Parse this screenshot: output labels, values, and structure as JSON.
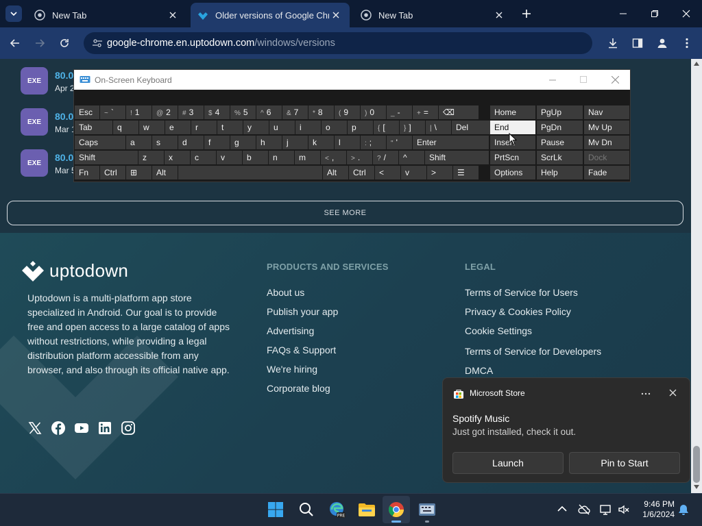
{
  "browser": {
    "tabs": [
      {
        "title": "New Tab",
        "active": false
      },
      {
        "title": "Older versions of Google Chrom",
        "active": true
      },
      {
        "title": "New Tab",
        "active": false
      }
    ],
    "url_host": "google-chrome.en.uptodown.com",
    "url_path": "/windows/versions"
  },
  "page": {
    "versions": [
      {
        "badge": "EXE",
        "number": "80.0",
        "date": "Apr 2"
      },
      {
        "badge": "EXE",
        "number": "80.0",
        "date": "Mar 1"
      },
      {
        "badge": "EXE",
        "number": "80.0",
        "date": "Mar 5"
      }
    ],
    "see_more": "SEE MORE",
    "footer": {
      "brand": "uptodown",
      "about": "Uptodown is a multi-platform app store specialized in Android. Our goal is to provide free and open access to a large catalog of apps without restrictions, while providing a legal distribution platform accessible from any browser, and also through its official native app.",
      "products_heading": "PRODUCTS AND SERVICES",
      "products": [
        "About us",
        "Publish your app",
        "Advertising",
        "FAQs & Support",
        "We're hiring",
        "Corporate blog"
      ],
      "legal_heading": "LEGAL",
      "legal": [
        "Terms of Service for Users",
        "Privacy & Cookies Policy",
        "Cookie Settings",
        "Terms of Service for Developers",
        "DMCA"
      ],
      "social_icons": [
        "x-icon",
        "facebook-icon",
        "youtube-icon",
        "linkedin-icon",
        "instagram-icon"
      ]
    }
  },
  "osk": {
    "title": "On-Screen Keyboard",
    "row1": [
      {
        "l": "Esc"
      },
      {
        "s": "~",
        "l": "`"
      },
      {
        "s": "!",
        "l": "1"
      },
      {
        "s": "@",
        "l": "2"
      },
      {
        "s": "#",
        "l": "3"
      },
      {
        "s": "$",
        "l": "4"
      },
      {
        "s": "%",
        "l": "5"
      },
      {
        "s": "^",
        "l": "6"
      },
      {
        "s": "&",
        "l": "7"
      },
      {
        "s": "*",
        "l": "8"
      },
      {
        "s": "(",
        "l": "9"
      },
      {
        "s": ")",
        "l": "0"
      },
      {
        "s": "_",
        "l": "-"
      },
      {
        "s": "+",
        "l": "="
      },
      {
        "l": "⌫"
      }
    ],
    "row2": [
      {
        "l": "Tab"
      },
      {
        "l": "q"
      },
      {
        "l": "w"
      },
      {
        "l": "e"
      },
      {
        "l": "r"
      },
      {
        "l": "t"
      },
      {
        "l": "y"
      },
      {
        "l": "u"
      },
      {
        "l": "i"
      },
      {
        "l": "o"
      },
      {
        "l": "p"
      },
      {
        "s": "{",
        "l": "["
      },
      {
        "s": "}",
        "l": "]"
      },
      {
        "s": "|",
        "l": "\\"
      },
      {
        "l": "Del"
      }
    ],
    "row3": [
      {
        "l": "Caps"
      },
      {
        "l": "a"
      },
      {
        "l": "s"
      },
      {
        "l": "d"
      },
      {
        "l": "f"
      },
      {
        "l": "g"
      },
      {
        "l": "h"
      },
      {
        "l": "j"
      },
      {
        "l": "k"
      },
      {
        "l": "l"
      },
      {
        "s": ":",
        "l": ";"
      },
      {
        "s": "\"",
        "l": "'"
      },
      {
        "l": "Enter"
      }
    ],
    "row4": [
      {
        "l": "Shift"
      },
      {
        "l": "z"
      },
      {
        "l": "x"
      },
      {
        "l": "c"
      },
      {
        "l": "v"
      },
      {
        "l": "b"
      },
      {
        "l": "n"
      },
      {
        "l": "m"
      },
      {
        "s": "<",
        "l": ","
      },
      {
        "s": ">",
        "l": "."
      },
      {
        "s": "?",
        "l": "/"
      },
      {
        "l": "^"
      },
      {
        "l": "Shift"
      }
    ],
    "row5": [
      {
        "l": "Fn"
      },
      {
        "l": "Ctrl"
      },
      {
        "l": "⊞"
      },
      {
        "l": "Alt"
      },
      {
        "l": ""
      },
      {
        "l": "Alt"
      },
      {
        "l": "Ctrl"
      },
      {
        "l": "<"
      },
      {
        "l": "v"
      },
      {
        "l": ">"
      },
      {
        "l": "☰"
      }
    ],
    "nav": [
      [
        "Home",
        "PgUp",
        "Nav"
      ],
      [
        "End",
        "PgDn",
        "Mv Up"
      ],
      [
        "Insert",
        "Pause",
        "Mv Dn"
      ],
      [
        "PrtScn",
        "ScrLk",
        "Dock"
      ],
      [
        "Options",
        "Help",
        "Fade"
      ]
    ]
  },
  "toast": {
    "app": "Microsoft Store",
    "title": "Spotify Music",
    "body": "Just got installed, check it out.",
    "launch": "Launch",
    "pin": "Pin to Start"
  },
  "taskbar": {
    "time": "9:46 PM",
    "date": "1/6/2024"
  }
}
